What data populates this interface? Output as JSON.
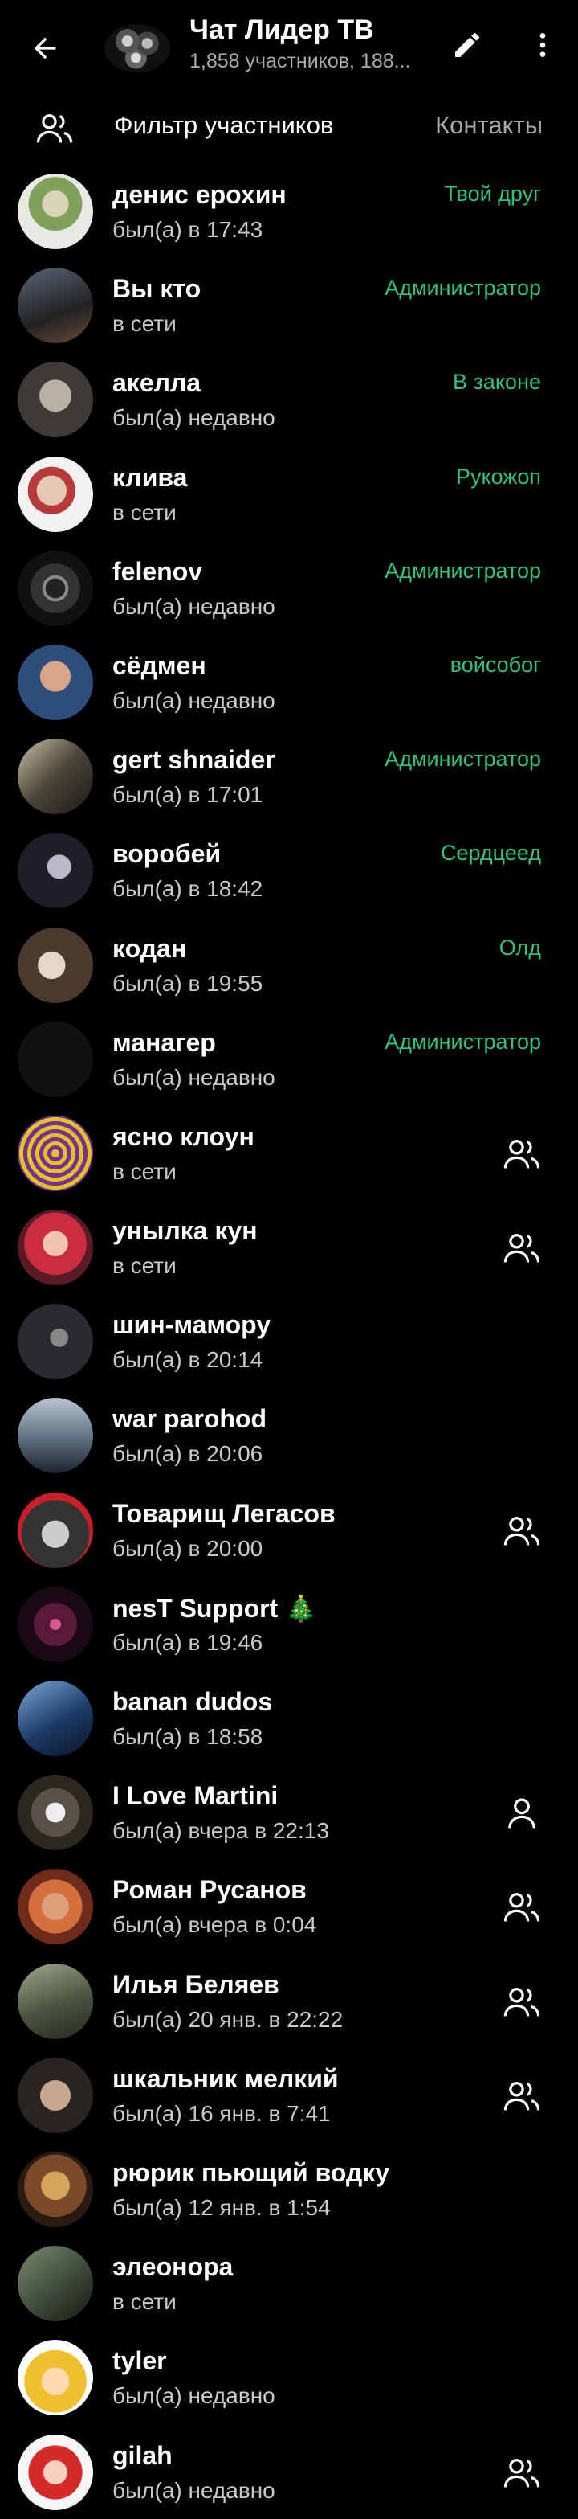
{
  "header": {
    "title": "Чат Лидер ТВ",
    "subtitle": "1,858 участников, 188...",
    "icons": {
      "back": "arrow-left-icon",
      "edit": "pencil-icon",
      "more": "more-vert-icon"
    }
  },
  "filter": {
    "label": "Фильтр участников",
    "contacts": "Контакты",
    "icon": "people-icon"
  },
  "colors": {
    "background": "#000000",
    "role": "#31c27c",
    "muted": "#a9a9a9"
  },
  "members": [
    {
      "name": "денис ерохин",
      "status": "был(а) в 17:43",
      "role": "Твой друг",
      "icon": null
    },
    {
      "name": "Вы кто",
      "status": "в сети",
      "role": "Администратор",
      "icon": null
    },
    {
      "name": "акелла",
      "status": "был(а) недавно",
      "role": "В законе",
      "icon": null
    },
    {
      "name": "клива",
      "status": "в сети",
      "role": "Рукожоп",
      "icon": null
    },
    {
      "name": "felenov",
      "status": "был(а) недавно",
      "role": "Администратор",
      "icon": null
    },
    {
      "name": "сёдмен",
      "status": "был(а) недавно",
      "role": "войсобог",
      "icon": null
    },
    {
      "name": "gert shnaider",
      "status": "был(а) в 17:01",
      "role": "Администратор",
      "icon": null
    },
    {
      "name": "воробей",
      "status": "был(а) в 18:42",
      "role": "Сердцеед",
      "icon": null
    },
    {
      "name": "кодан",
      "status": "был(а) в 19:55",
      "role": "Олд",
      "icon": null
    },
    {
      "name": "манагер",
      "status": "был(а) недавно",
      "role": "Администратор",
      "icon": null
    },
    {
      "name": "ясно клоун",
      "status": "в сети",
      "role": "",
      "icon": "people-icon"
    },
    {
      "name": "унылка кун",
      "status": "в сети",
      "role": "",
      "icon": "people-icon"
    },
    {
      "name": "шин-мамору",
      "status": "был(а) в 20:14",
      "role": "",
      "icon": null
    },
    {
      "name": "war parohod",
      "status": "был(а) в 20:06",
      "role": "",
      "icon": null
    },
    {
      "name": "Товарищ Легасов",
      "status": "был(а) в 20:00",
      "role": "",
      "icon": "people-icon"
    },
    {
      "name": "nesT Support 🎄",
      "status": "был(а) в 19:46",
      "role": "",
      "icon": null
    },
    {
      "name": "banan dudos",
      "status": "был(а) в 18:58",
      "role": "",
      "icon": null
    },
    {
      "name": "I Love Martini",
      "status": "был(а) вчера в 22:13",
      "role": "",
      "icon": "person-icon"
    },
    {
      "name": "Роман Русанов",
      "status": "был(а) вчера в 0:04",
      "role": "",
      "icon": "people-icon"
    },
    {
      "name": "Илья Беляев",
      "status": "был(а) 20 янв. в 22:22",
      "role": "",
      "icon": "people-icon"
    },
    {
      "name": "шкальник мелкий",
      "status": "был(а) 16 янв. в 7:41",
      "role": "",
      "icon": "people-icon"
    },
    {
      "name": "рюрик пьющий водку",
      "status": "был(а) 12 янв. в 1:54",
      "role": "",
      "icon": null
    },
    {
      "name": "элеонора",
      "status": "в сети",
      "role": "",
      "icon": null
    },
    {
      "name": "tyler",
      "status": "был(а) недавно",
      "role": "",
      "icon": null
    },
    {
      "name": "gilah",
      "status": "был(а) недавно",
      "role": "",
      "icon": "people-icon"
    }
  ]
}
